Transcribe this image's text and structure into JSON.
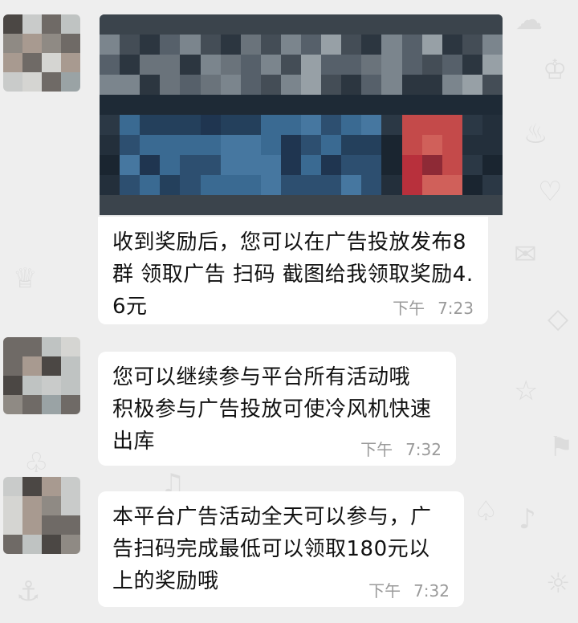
{
  "chat": {
    "messages": [
      {
        "type": "image",
        "caption": "收到奖励后，您可以在广告投放发布8群 领取广告 扫码 截图给我领取奖励4.6元",
        "period": "下午",
        "time": "7:23"
      },
      {
        "type": "text",
        "text": "您可以继续参与平台所有活动哦  积极参与广告投放可使冷风机快速出库",
        "period": "下午",
        "time": "7:32"
      },
      {
        "type": "text",
        "text": "本平台广告活动全天可以参与，广告扫码完成最低可以领取180元以上的奖励哦",
        "period": "下午",
        "time": "7:32"
      }
    ]
  },
  "colors": {
    "background": "#eeeeee",
    "bubble": "#ffffff",
    "text": "#111111",
    "time": "#9a9a9a"
  },
  "icons": [
    "avatar-pixelated",
    "image-pixelated"
  ]
}
